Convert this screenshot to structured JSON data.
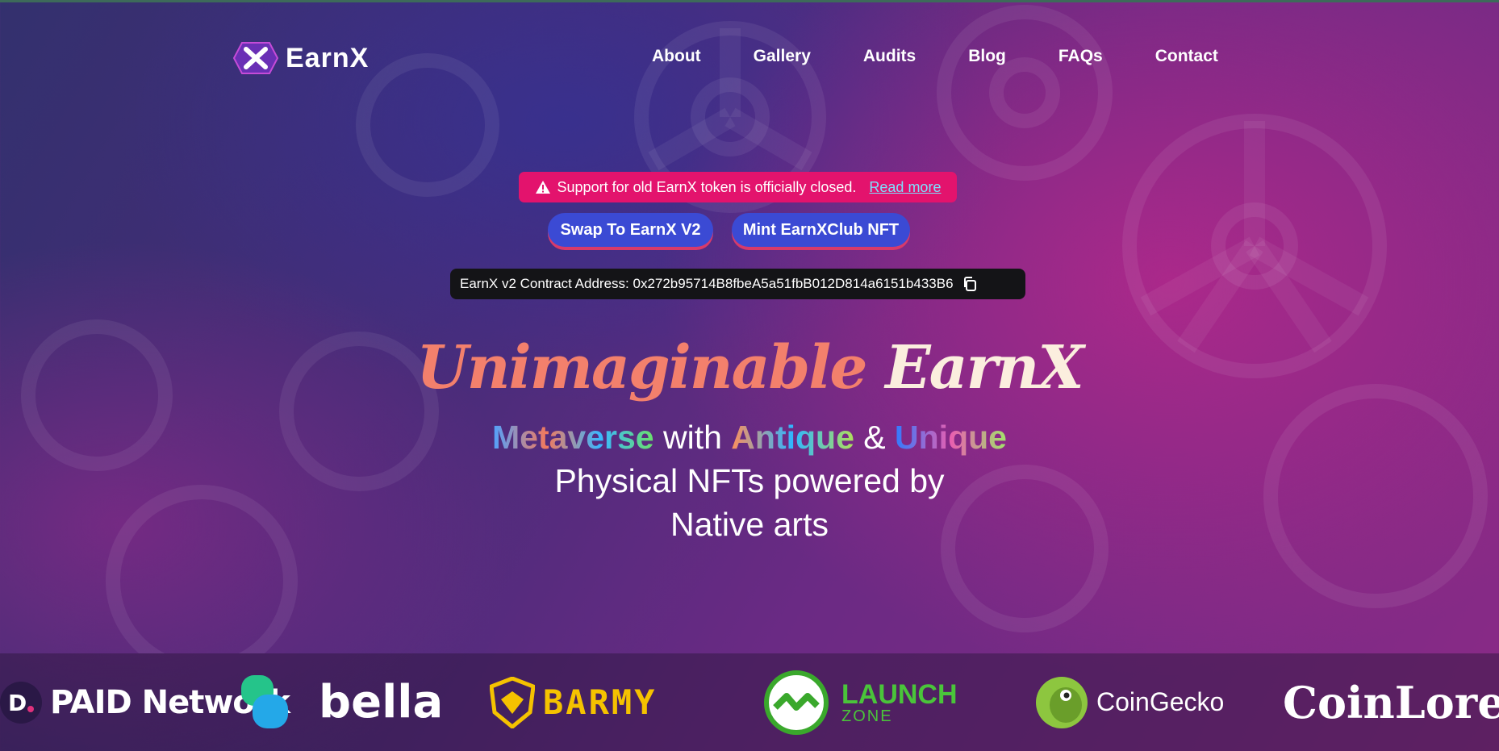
{
  "header": {
    "logo_text": "EarnX",
    "nav": [
      "About",
      "Gallery",
      "Audits",
      "Blog",
      "FAQs",
      "Contact"
    ]
  },
  "alert": {
    "icon": "warning-icon",
    "message": "Support for old EarnX token is officially closed.",
    "link_label": "Read more"
  },
  "actions": {
    "swap_label": "Swap To EarnX V2",
    "mint_label": "Mint EarnXClub NFT"
  },
  "contract": {
    "label": "EarnX v2 Contract Address: 0x272b95714B8fbeA5a51fbB012D814a6151b433B6",
    "copy_icon": "copy-icon"
  },
  "hero": {
    "headline_part1": "Unimaginable",
    "headline_part2": "EarnX",
    "word1": "Metaverse",
    "with": " with ",
    "word2": "Antique",
    "amp": " & ",
    "word3": "Unique",
    "line2": "Physical NFTs powered by",
    "line3": "Native arts"
  },
  "partners": {
    "paid": "PAID Network",
    "bella": "bella",
    "barmy": "BARMY",
    "launch_1": "LAUNCH",
    "launch_2": "ZONE",
    "coingecko": "CoinGecko",
    "coinlore": "CoinLore"
  },
  "colors": {
    "alert_bg": "#e3136d",
    "button_bg": "#3b4ad4",
    "button_shadow": "#d83a6a",
    "contract_bg": "#141417",
    "link": "#7ee0ff"
  }
}
